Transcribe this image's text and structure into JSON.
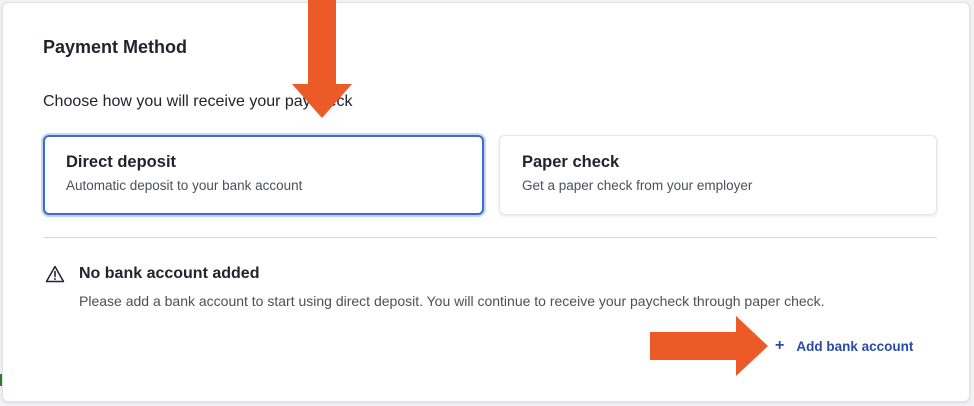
{
  "section": {
    "title": "Payment Method",
    "subtitle": "Choose how you will receive your paycheck"
  },
  "options": [
    {
      "title": "Direct deposit",
      "description": "Automatic deposit to your bank account",
      "selected": true
    },
    {
      "title": "Paper check",
      "description": "Get a paper check from your employer",
      "selected": false
    }
  ],
  "notice": {
    "icon": "warning-triangle-icon",
    "title": "No bank account added",
    "text": "Please add a bank account to start using direct deposit. You will continue to receive your paycheck through paper check."
  },
  "actions": {
    "add_bank_account_icon": "+",
    "add_bank_account_label": "Add bank account"
  },
  "annotations": {
    "arrow_color": "#EB5A27"
  },
  "colors": {
    "accent": "#3a6fd0",
    "link": "#2a4aa8",
    "text": "#22232e"
  }
}
